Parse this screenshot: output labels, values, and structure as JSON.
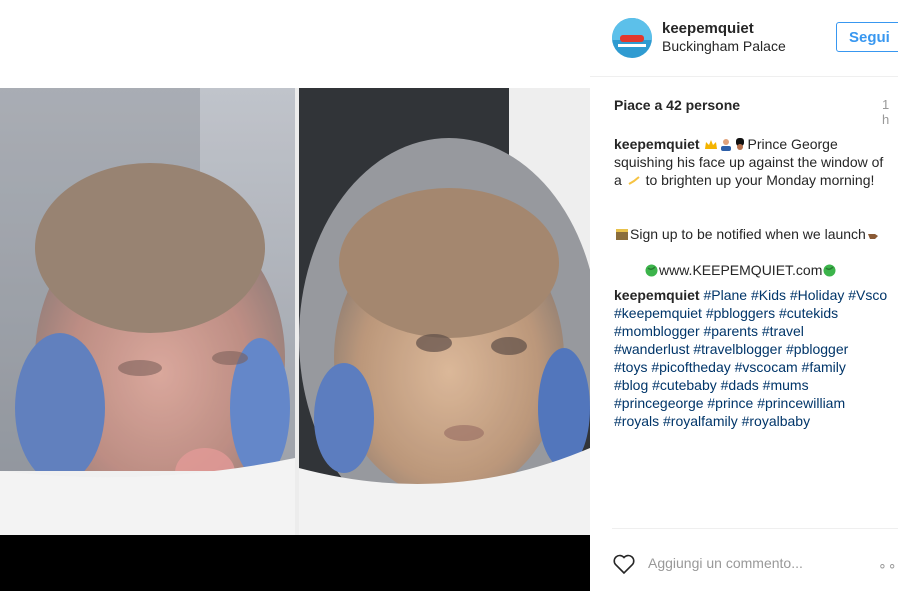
{
  "post": {
    "username": "keepemquiet",
    "location": "Buckingham Palace",
    "follow_label": "Segui",
    "likes_text": "Piace a 42 persone",
    "time_text": "1 h",
    "caption_line1": "Prince George",
    "caption_line2": "squishing his face up against the window of",
    "caption_line3_a": "a",
    "caption_line3_b": "to brighten up your Monday morning!",
    "caption_line4": "Sign up to be notified when we launch",
    "caption_line5": "www.KEEPEMQUIET.com",
    "tags_lines": [
      "#Plane #Kids #Holiday #Vsco",
      "#keepemquiet #pbloggers #cutekids",
      "#momblogger #parents #travel",
      "#wanderlust #travelblogger #pblogger",
      "#toys #picoftheday #vscocam #family",
      "#blog #cutebaby #dads #mums",
      "#princegeorge #prince #princewilliam",
      "#royals #royalfamily #royalbaby"
    ]
  },
  "footer": {
    "comment_placeholder": "Aggiungi un commento...",
    "more_label": "∘∘∘"
  },
  "icons": {
    "heart": "heart-icon",
    "more": "more-options-icon"
  },
  "colors": {
    "link": "#003569",
    "follow": "#3897f0"
  }
}
